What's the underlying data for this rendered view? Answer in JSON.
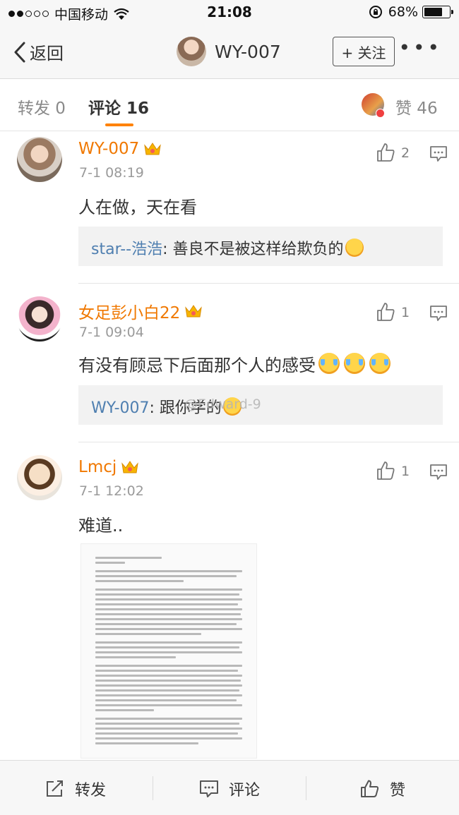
{
  "status_bar": {
    "carrier": "中国移动",
    "time": "21:08",
    "battery": "68%",
    "battery_level": 0.68
  },
  "nav": {
    "back_label": "返回",
    "title": "WY-007",
    "follow_label": "+ 关注",
    "more_label": "•••"
  },
  "tabs": {
    "repost": "转发 0",
    "comments": "评论 16",
    "likes": "赞 46"
  },
  "comments": [
    {
      "name": "WY-007",
      "time": "7-1 08:19",
      "text": "人在做，天在看",
      "likes": "2",
      "reply_name": "star--浩浩",
      "reply_text": ": 善良不是被这样给欺负的"
    },
    {
      "name": "女足彭小白22",
      "time": "7-1 09:04",
      "text": "有没有顾忌下后面那个人的感受",
      "likes": "1",
      "reply_name": "WY-007",
      "reply_text": ": 跟你学的"
    },
    {
      "name": "Lmcj",
      "time": "7-1 12:02",
      "text": "难道..",
      "likes": "1"
    }
  ],
  "watermark": "@Edward-9",
  "bottom_bar": {
    "repost": "转发",
    "comment": "评论",
    "like": "赞"
  },
  "colors": {
    "accent": "#ff8200",
    "name": "#f07800",
    "link": "#4f7fb0"
  }
}
